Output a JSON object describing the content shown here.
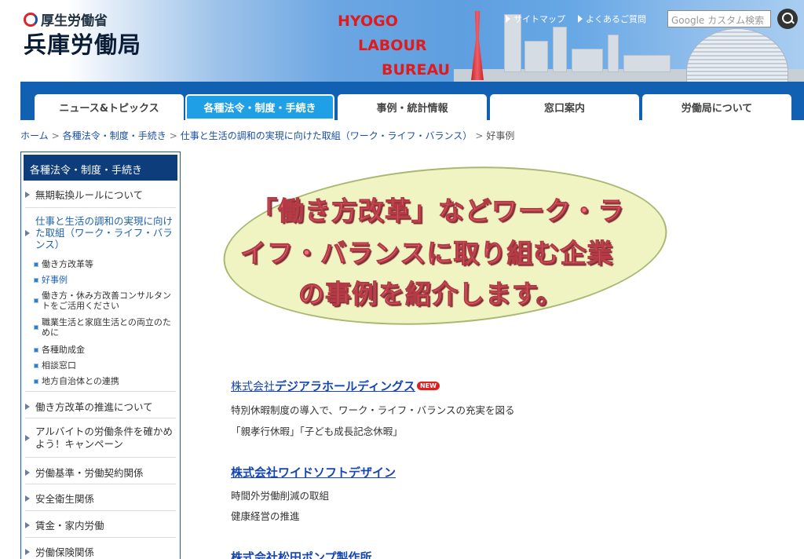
{
  "header": {
    "ministry": "厚生労働省",
    "bureau": "兵庫労働局",
    "english": [
      "HYOGO",
      "LABOUR",
      "BUREAU"
    ],
    "sitemap": "サイトマップ",
    "faq": "よくあるご質問",
    "search_placeholder": "Google カスタム検索"
  },
  "nav": {
    "tabs": [
      "ニュース&トピックス",
      "各種法令・制度・手続き",
      "事例・統計情報",
      "窓口案内",
      "労働局について"
    ],
    "active_index": 1
  },
  "breadcrumb": [
    "ホーム",
    "各種法令・制度・手続き",
    "仕事と生活の調和の実現に向けた取組（ワーク・ライフ・バランス）",
    "好事例"
  ],
  "sidebar": {
    "heading": "各種法令・制度・手続き",
    "items": [
      "無期転換ルールについて",
      "仕事と生活の調和の実現に向けた取組（ワーク・ライフ・バランス）",
      "働き方改革の推進について",
      "アルバイトの労働条件を確かめよう！キャンペーン",
      "労働基準・労働契約関係",
      "安全衛生関係",
      "賃金・家内労働",
      "労働保険関係"
    ],
    "subitems": [
      "働き方改革等",
      "好事例",
      "働き方・休み方改善コンサルタントをご活用ください",
      "職業生活と家庭生活との両立のために",
      "各種助成金",
      "相談窓口",
      "地方自治体との連携"
    ]
  },
  "banner": {
    "lines": [
      "「働き方改革」などワーク・ラ",
      "イフ・バランスに取り組む企業",
      "の事例を紹介します。"
    ]
  },
  "cases": [
    {
      "prefix": "株式会社",
      "name": "デジアラホールディングス",
      "badge": "NEW",
      "lines": [
        "特別休暇制度の導入で、ワーク・ライフ・バランスの充実を図る",
        "「親孝行休暇」「子ども成長記念休暇」"
      ]
    },
    {
      "prefix": "",
      "name": "株式会社ワイドソフトデザイン",
      "badge": "",
      "lines": [
        "時間外労働削減の取組",
        "健康経営の推進"
      ]
    },
    {
      "prefix": "",
      "name": "株式会社松田ポンプ製作所",
      "badge": "",
      "lines": []
    }
  ],
  "colors": {
    "nav_bg": "#1160b2",
    "active_tab": "#1fa0e6",
    "sidebar_head": "#0d3d7a",
    "link": "#1646b3",
    "banner_text": "#f2727a"
  }
}
